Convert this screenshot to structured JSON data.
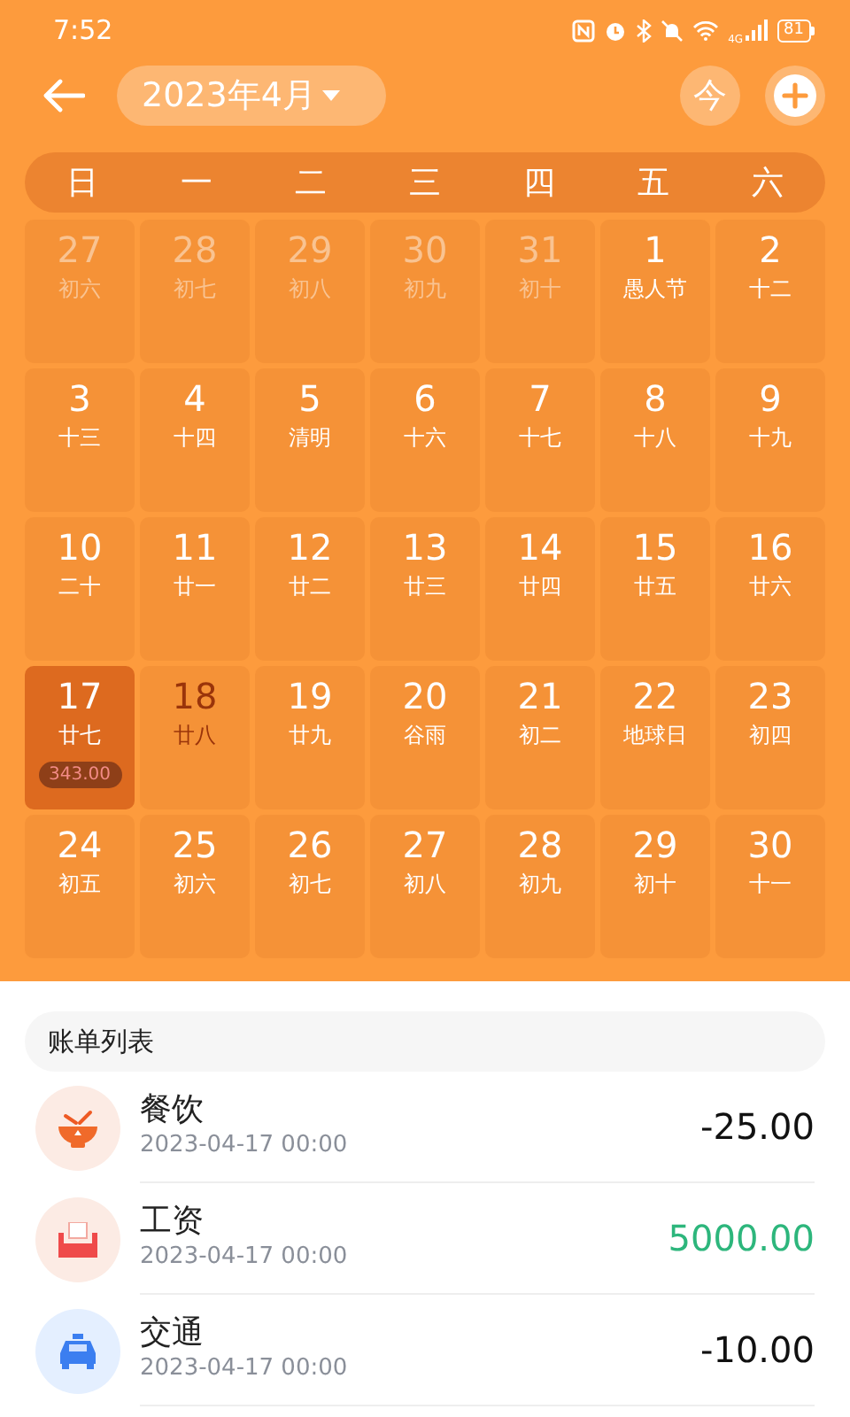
{
  "status_bar": {
    "time": "7:52",
    "network": "4G",
    "battery": "81"
  },
  "header": {
    "month": "2023年4月",
    "today_button": "今"
  },
  "weekdays": [
    "日",
    "一",
    "二",
    "三",
    "四",
    "五",
    "六"
  ],
  "days": [
    {
      "day": "27",
      "lunar": "初六",
      "in_month": false,
      "selected": false,
      "today": false
    },
    {
      "day": "28",
      "lunar": "初七",
      "in_month": false,
      "selected": false,
      "today": false
    },
    {
      "day": "29",
      "lunar": "初八",
      "in_month": false,
      "selected": false,
      "today": false
    },
    {
      "day": "30",
      "lunar": "初九",
      "in_month": false,
      "selected": false,
      "today": false
    },
    {
      "day": "31",
      "lunar": "初十",
      "in_month": false,
      "selected": false,
      "today": false
    },
    {
      "day": "1",
      "lunar": "愚人节",
      "in_month": true,
      "selected": false,
      "today": false
    },
    {
      "day": "2",
      "lunar": "十二",
      "in_month": true,
      "selected": false,
      "today": false
    },
    {
      "day": "3",
      "lunar": "十三",
      "in_month": true,
      "selected": false,
      "today": false
    },
    {
      "day": "4",
      "lunar": "十四",
      "in_month": true,
      "selected": false,
      "today": false
    },
    {
      "day": "5",
      "lunar": "清明",
      "in_month": true,
      "selected": false,
      "today": false
    },
    {
      "day": "6",
      "lunar": "十六",
      "in_month": true,
      "selected": false,
      "today": false
    },
    {
      "day": "7",
      "lunar": "十七",
      "in_month": true,
      "selected": false,
      "today": false
    },
    {
      "day": "8",
      "lunar": "十八",
      "in_month": true,
      "selected": false,
      "today": false
    },
    {
      "day": "9",
      "lunar": "十九",
      "in_month": true,
      "selected": false,
      "today": false
    },
    {
      "day": "10",
      "lunar": "二十",
      "in_month": true,
      "selected": false,
      "today": false
    },
    {
      "day": "11",
      "lunar": "廿一",
      "in_month": true,
      "selected": false,
      "today": false
    },
    {
      "day": "12",
      "lunar": "廿二",
      "in_month": true,
      "selected": false,
      "today": false
    },
    {
      "day": "13",
      "lunar": "廿三",
      "in_month": true,
      "selected": false,
      "today": false
    },
    {
      "day": "14",
      "lunar": "廿四",
      "in_month": true,
      "selected": false,
      "today": false
    },
    {
      "day": "15",
      "lunar": "廿五",
      "in_month": true,
      "selected": false,
      "today": false
    },
    {
      "day": "16",
      "lunar": "廿六",
      "in_month": true,
      "selected": false,
      "today": false
    },
    {
      "day": "17",
      "lunar": "廿七",
      "in_month": true,
      "selected": true,
      "today": false,
      "amount": "343.00"
    },
    {
      "day": "18",
      "lunar": "廿八",
      "in_month": true,
      "selected": false,
      "today": true
    },
    {
      "day": "19",
      "lunar": "廿九",
      "in_month": true,
      "selected": false,
      "today": false
    },
    {
      "day": "20",
      "lunar": "谷雨",
      "in_month": true,
      "selected": false,
      "today": false
    },
    {
      "day": "21",
      "lunar": "初二",
      "in_month": true,
      "selected": false,
      "today": false
    },
    {
      "day": "22",
      "lunar": "地球日",
      "in_month": true,
      "selected": false,
      "today": false
    },
    {
      "day": "23",
      "lunar": "初四",
      "in_month": true,
      "selected": false,
      "today": false
    },
    {
      "day": "24",
      "lunar": "初五",
      "in_month": true,
      "selected": false,
      "today": false
    },
    {
      "day": "25",
      "lunar": "初六",
      "in_month": true,
      "selected": false,
      "today": false
    },
    {
      "day": "26",
      "lunar": "初七",
      "in_month": true,
      "selected": false,
      "today": false
    },
    {
      "day": "27",
      "lunar": "初八",
      "in_month": true,
      "selected": false,
      "today": false
    },
    {
      "day": "28",
      "lunar": "初九",
      "in_month": true,
      "selected": false,
      "today": false
    },
    {
      "day": "29",
      "lunar": "初十",
      "in_month": true,
      "selected": false,
      "today": false
    },
    {
      "day": "30",
      "lunar": "十一",
      "in_month": true,
      "selected": false,
      "today": false
    }
  ],
  "bill_list": {
    "title": "账单列表",
    "items": [
      {
        "kind": "food",
        "name": "餐饮",
        "time": "2023-04-17 00:00",
        "amount": "-25.00",
        "income": false
      },
      {
        "kind": "salary",
        "name": "工资",
        "time": "2023-04-17 00:00",
        "amount": "5000.00",
        "income": true
      },
      {
        "kind": "transport",
        "name": "交通",
        "time": "2023-04-17 00:00",
        "amount": "-10.00",
        "income": false
      }
    ]
  }
}
